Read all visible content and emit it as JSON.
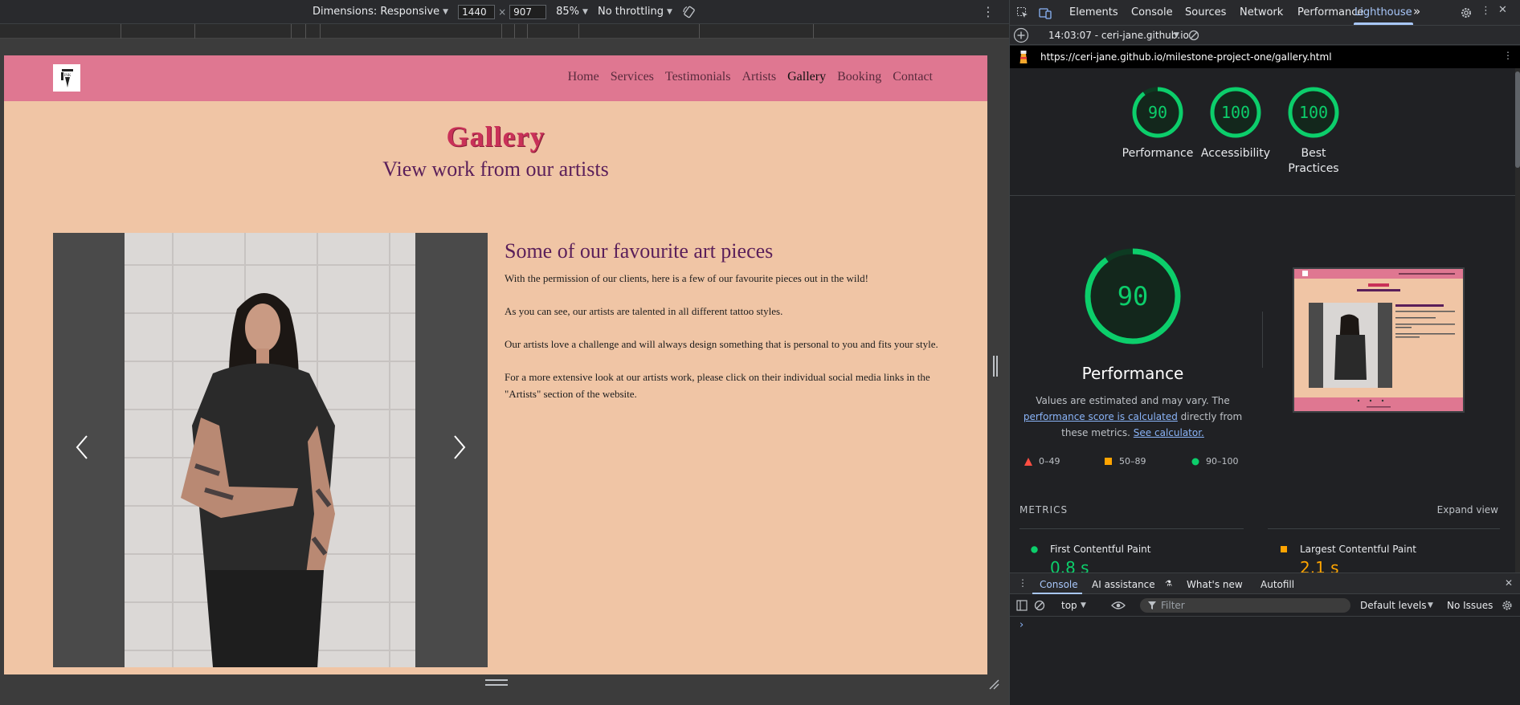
{
  "device_toolbar": {
    "dimensions_label": "Dimensions: Responsive",
    "width": "1440",
    "height": "907",
    "times": "×",
    "zoom": "85%",
    "throttling": "No throttling"
  },
  "site": {
    "nav": [
      "Home",
      "Services",
      "Testimonials",
      "Artists",
      "Gallery",
      "Booking",
      "Contact"
    ],
    "active_nav": "Gallery",
    "title": "Gallery",
    "subtitle": "View work from our artists",
    "section_heading": "Some of our favourite art pieces",
    "paragraphs": [
      "With the permission of our clients, here is a few of our favourite pieces out in the wild!",
      "As you can see, our artists are talented in all different tattoo styles.",
      "Our artists love a challenge and will always design something that is personal to you and fits your style.",
      "For a more extensive look at our artists work, please click on their individual social media links in the \"Artists\" section of the website."
    ],
    "colors": {
      "nav": "#df7791",
      "page": "#f0c5a5",
      "title": "#c93158",
      "heading": "#5a1f5a"
    }
  },
  "devtools": {
    "tabs": [
      "Elements",
      "Console",
      "Sources",
      "Network",
      "Performance",
      "Lighthouse"
    ],
    "active_tab": "Lighthouse",
    "report_time": "14:03:07 - ceri-jane.github.io",
    "url": "https://ceri-jane.github.io/milestone-project-one/gallery.html",
    "scores": [
      {
        "label": "Performance",
        "value": 90
      },
      {
        "label": "Accessibility",
        "value": 100
      },
      {
        "label": "Best Practices",
        "value": 100
      }
    ],
    "performance": {
      "score": 90,
      "title": "Performance",
      "desc_prefix": "Values are estimated and may vary. The",
      "desc_link": "performance score is calculated",
      "desc_mid": "directly from these metrics.",
      "desc_link2": "See calculator."
    },
    "legend": [
      "0–49",
      "50–89",
      "90–100"
    ],
    "metrics_header": "METRICS",
    "expand_view": "Expand view",
    "metrics": [
      {
        "name": "First Contentful Paint",
        "value": "0.8 s",
        "status": "pass"
      },
      {
        "name": "Largest Contentful Paint",
        "value": "2.1 s",
        "status": "average"
      }
    ],
    "drawer_tabs": [
      "Console",
      "AI assistance",
      "What's new",
      "Autofill"
    ],
    "active_drawer_tab": "Console",
    "console": {
      "context": "top",
      "filter_placeholder": "Filter",
      "levels": "Default levels",
      "issues": "No Issues",
      "prompt": "›"
    },
    "colors": {
      "pass": "#0cce6b",
      "average": "#ffa400",
      "fail": "#ff4e42",
      "accent": "#a8c7fa"
    }
  }
}
